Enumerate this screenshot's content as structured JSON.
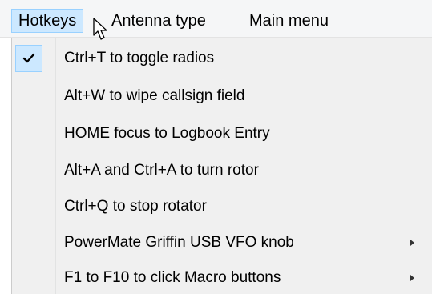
{
  "menubar": {
    "items": [
      {
        "label": "Hotkeys"
      },
      {
        "label": "Antenna type"
      },
      {
        "label": "Main menu"
      }
    ]
  },
  "dropdown": {
    "items": [
      {
        "label": "Ctrl+T to toggle radios",
        "checked": true
      },
      {
        "label": "Alt+W to wipe callsign field"
      },
      {
        "label": "HOME focus to Logbook Entry"
      },
      {
        "label": "Alt+A and Ctrl+A to turn rotor"
      },
      {
        "label": "Ctrl+Q to stop rotator"
      },
      {
        "label": "PowerMate Griffin USB VFO knob",
        "submenu": true
      },
      {
        "label": "F1 to F10 to click Macro buttons",
        "submenu": true
      }
    ]
  },
  "colors": {
    "highlight": "#cce8ff",
    "highlight_border": "#99d1ff",
    "menu_background": "#f0f0f0"
  },
  "icons": {
    "check": "check-icon",
    "submenu": "submenu-arrow-icon",
    "cursor": "mouse-pointer-icon"
  }
}
